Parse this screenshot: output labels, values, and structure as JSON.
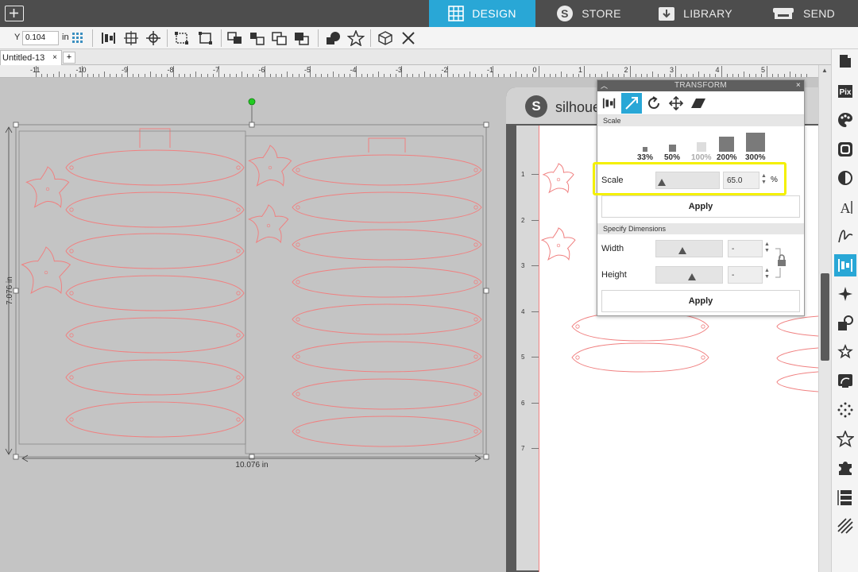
{
  "nav": {
    "design": "DESIGN",
    "store": "STORE",
    "library": "LIBRARY",
    "send": "SEND",
    "accent": "#29a7d6"
  },
  "toolbar": {
    "y_label": "Y",
    "y_value": "0.104",
    "unit": "in"
  },
  "tabs": {
    "doc_name": "Untitled-13",
    "close": "×",
    "add": "+"
  },
  "ruler": {
    "labels": [
      "-11",
      "-10",
      "-9",
      "-8",
      "-7",
      "-6",
      "-5",
      "-4",
      "-3",
      "-2",
      "-1",
      "0",
      "1",
      "2",
      "3",
      "4",
      "5"
    ]
  },
  "mat_ruler": {
    "labels": [
      "1",
      "2",
      "3",
      "4",
      "5",
      "6",
      "7"
    ]
  },
  "mat": {
    "brand": "silhoue"
  },
  "selection": {
    "height": "7.076 in",
    "width": "10.076 in"
  },
  "panel": {
    "title": "TRANSFORM",
    "close": "×",
    "scale_section": "Scale",
    "presets": [
      "33%",
      "50%",
      "100%",
      "200%",
      "300%"
    ],
    "scale_label": "Scale",
    "scale_value": "65.0",
    "scale_unit": "%",
    "apply": "Apply",
    "dimensions_section": "Specify Dimensions",
    "width_label": "Width",
    "width_value": "-",
    "height_label": "Height",
    "height_value": "-",
    "apply2": "Apply"
  },
  "sidebar": {
    "icons": [
      "page-setup-icon",
      "pixscan-icon",
      "fill-palette-icon",
      "texture-icon",
      "line-style-icon",
      "text-style-icon",
      "sketch-icon",
      "transform-icon",
      "replicate-icon",
      "modify-icon",
      "offset-icon",
      "trace-icon",
      "point-editing-icon",
      "favorite-icon",
      "puzzle-icon",
      "layers-icon",
      "hatch-icon"
    ],
    "pix_label": "Pix"
  },
  "colors": {
    "cut_line": "#f08080",
    "highlight": "#f4f000"
  }
}
